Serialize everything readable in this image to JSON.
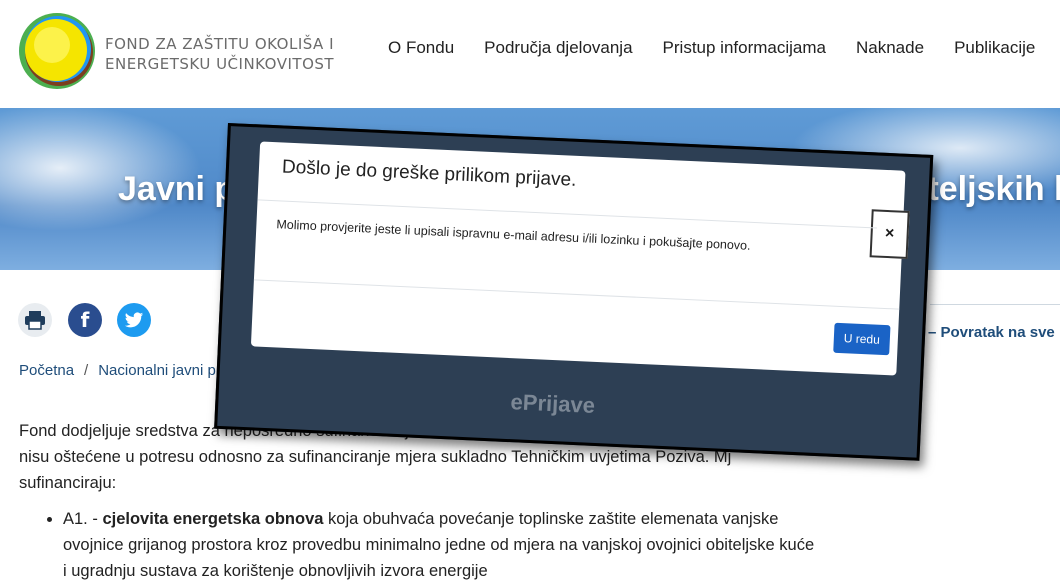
{
  "header": {
    "logo_line1": "FOND ZA ZAŠTITU OKOLIŠA I",
    "logo_line2": "ENERGETSKU UČINKOVITOST",
    "nav": [
      "O Fondu",
      "Područja djelovanja",
      "Pristup informacijama",
      "Naknade",
      "Publikacije"
    ]
  },
  "hero": {
    "title_left": "Javni p",
    "title_right": "iteljskih k"
  },
  "social": {
    "icons": [
      "print-icon",
      "facebook-icon",
      "twitter-icon"
    ]
  },
  "back_link": "Povratak na sve",
  "breadcrumb": {
    "items": [
      "Početna",
      "Nacionalni javni p"
    ]
  },
  "content": {
    "paragraph_start": "Fond dodjeljuje sredstva za neposredno sufinanciranje",
    "paragraph_mid": "nisu oštećene u potresu odnosno za sufinanciranje mjera sukladno Tehničkim uvjetima Poziva. Mj",
    "paragraph_end": "sufinanciraju:",
    "bullet_prefix": "A1. - ",
    "bullet_bold": "cjelovita energetska obnova",
    "bullet_rest": " koja obuhvaća povećanje toplinske zaštite elemenata vanjske ovojnice grijanog prostora kroz provedbu minimalno jedne od mjera na vanjskoj ovojnici obiteljske kuće i ugradnju sustava za korištenje obnovljivih izvora energije"
  },
  "modal_screenshot": {
    "title": "Došlo je do greške prilikom prijave.",
    "close_label": "×",
    "message": "Molimo provjerite jeste li upisali ispravnu e-mail adresu i/ili lozinku i pokušajte ponovo.",
    "ok_label": "U redu",
    "bg_text1": "ENERGETSKU UČINKOVITOST",
    "bg_text2": "ePrijave"
  },
  "colors": {
    "link": "#1f4d7a",
    "facebook": "#2a4d8f",
    "twitter": "#1d9bf0",
    "modal_backdrop": "#2d3f54",
    "ok_button": "#1a63c6"
  }
}
